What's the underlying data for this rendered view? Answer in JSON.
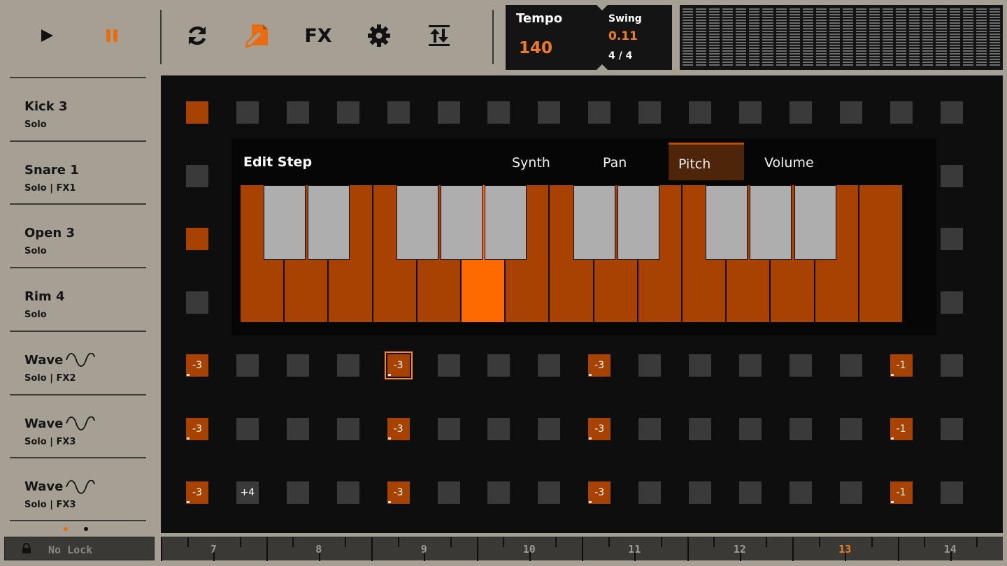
{
  "toolbar": {
    "icons": [
      "play-icon",
      "pause-icon",
      "loop-icon",
      "edit-pattern-icon",
      "fx-label",
      "gear-icon",
      "sort-icon"
    ],
    "fx_label": "FX",
    "accent": "#f07e20"
  },
  "tempo": {
    "label": "Tempo",
    "value": "140"
  },
  "swing": {
    "label": "Swing",
    "value": "0.11",
    "time_signature": "4 / 4"
  },
  "tracks": [
    {
      "name": "Kick 3",
      "sub": "Solo"
    },
    {
      "name": "Snare 1",
      "sub": "Solo | FX1"
    },
    {
      "name": "Open 3",
      "sub": "Solo"
    },
    {
      "name": "Rim 4",
      "sub": "Solo"
    },
    {
      "name": "Wave",
      "sub": "Solo | FX2",
      "icon": "sine-wave-icon"
    },
    {
      "name": "Wave",
      "sub": "Solo | FX3",
      "icon": "sine-wave-icon"
    },
    {
      "name": "Wave",
      "sub": "Solo | FX3",
      "icon": "sine-wave-icon"
    }
  ],
  "lock": {
    "label": "No Lock",
    "icon": "lock-icon"
  },
  "grid_rows": [
    {
      "cells": [
        {
          "on": true
        },
        {},
        {},
        {},
        {},
        {},
        {},
        {},
        {},
        {},
        {},
        {},
        {},
        {},
        {},
        {}
      ]
    },
    {
      "cells": [
        {},
        {},
        {},
        {},
        {},
        {},
        {},
        {},
        {},
        {},
        {},
        {},
        {},
        {},
        {},
        {}
      ]
    },
    {
      "cells": [
        {
          "on": true
        },
        {},
        {},
        {},
        {},
        {},
        {},
        {},
        {},
        {},
        {},
        {},
        {},
        {},
        {},
        {}
      ]
    },
    {
      "cells": [
        {},
        {},
        {},
        {},
        {},
        {},
        {},
        {},
        {},
        {},
        {},
        {},
        {},
        {},
        {},
        {}
      ]
    },
    {
      "cells": [
        {
          "on": true,
          "label": "-3"
        },
        {},
        {},
        {},
        {
          "on": true,
          "label": "-3",
          "selected": true
        },
        {},
        {},
        {},
        {
          "on": true,
          "label": "-3"
        },
        {},
        {},
        {},
        {},
        {},
        {
          "on": true,
          "label": "-1"
        },
        {}
      ]
    },
    {
      "cells": [
        {
          "on": true,
          "label": "-3"
        },
        {},
        {},
        {},
        {
          "on": true,
          "label": "-3"
        },
        {},
        {},
        {},
        {
          "on": true,
          "label": "-3"
        },
        {},
        {},
        {},
        {},
        {},
        {
          "on": true,
          "label": "-1"
        },
        {}
      ]
    },
    {
      "cells": [
        {
          "on": true,
          "label": "-3"
        },
        {
          "label": "+4"
        },
        {},
        {},
        {
          "on": true,
          "label": "-3"
        },
        {},
        {},
        {},
        {
          "on": true,
          "label": "-3"
        },
        {},
        {},
        {},
        {},
        {},
        {
          "on": true,
          "label": "-1"
        },
        {}
      ]
    }
  ],
  "popup": {
    "title": "Edit Step",
    "tabs": [
      "Synth",
      "Pan",
      "Pitch",
      "Volume"
    ],
    "active_tab": "Pitch",
    "keyboard": {
      "white_keys": 15,
      "lit_white_key": 5,
      "black_after_white": [
        0,
        1,
        3,
        4,
        5,
        7,
        8,
        10,
        11,
        12
      ]
    }
  },
  "ruler": {
    "bars": [
      "7",
      "8",
      "9",
      "10",
      "11",
      "12",
      "13",
      "14"
    ],
    "current": "13"
  }
}
